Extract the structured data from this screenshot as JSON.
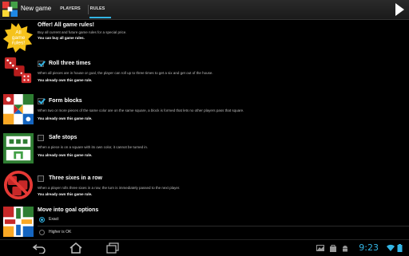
{
  "app": {
    "title": "New game"
  },
  "tabs": [
    {
      "label": "PLAYERS",
      "selected": false
    },
    {
      "label": "RULES",
      "selected": true
    }
  ],
  "colors": {
    "accent": "#33b5e5",
    "background": "#000000",
    "actionbar": "#222222"
  },
  "offer": {
    "badge_line1": "All",
    "badge_line2": "game",
    "badge_line3": "rules!",
    "title": "Offer! All game rules!",
    "desc": "Buy all current and future game rules for a special price.",
    "note": "You can buy all game rules."
  },
  "rules": [
    {
      "title": "Roll three times",
      "checked": true,
      "desc": "When all pieces are in house or goal, the player can roll up to three times to get a six and get out of the house.",
      "owned": "You already own this game rule."
    },
    {
      "title": "Form blocks",
      "checked": true,
      "desc": "When two or more pieces of the same color are on the same square, a block is formed that lets no other players pass that square.",
      "owned": "You already own this game rule."
    },
    {
      "title": "Safe stops",
      "checked": false,
      "desc": "When a piece is on a square with its own color, it cannot be turned in.",
      "owned": "You already own this game rule."
    },
    {
      "title": "Three sixes in a row",
      "checked": false,
      "desc": "When a player rolls three sixes in a row, the turn is immediately passed to the next player.",
      "owned": "You already own this game rule."
    }
  ],
  "goal_options": {
    "title": "Move into goal options",
    "options": [
      {
        "label": "Exact",
        "selected": true
      },
      {
        "label": "Higher is OK",
        "selected": false
      }
    ]
  },
  "status": {
    "time": "9:23"
  },
  "icons": [
    "back-icon",
    "home-icon",
    "recent-apps-icon",
    "gallery-icon",
    "shopping-bag-icon",
    "android-icon",
    "wifi-icon",
    "battery-icon"
  ]
}
